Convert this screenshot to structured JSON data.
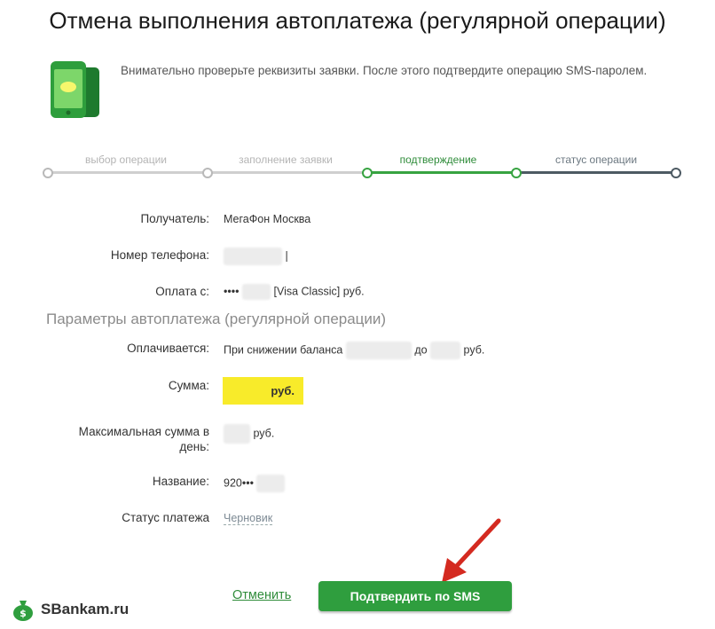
{
  "page": {
    "title": "Отмена выполнения автоплатежа (регулярной операции)",
    "intro": "Внимательно проверьте реквизиты заявки. После этого подтвердите операцию SMS-паролем."
  },
  "steps": [
    {
      "label": "выбор операции",
      "state": "done"
    },
    {
      "label": "заполнение заявки",
      "state": "done"
    },
    {
      "label": "подтверждение",
      "state": "active"
    },
    {
      "label": "статус операции",
      "state": "pending"
    }
  ],
  "details": {
    "recipient_label": "Получатель:",
    "recipient_value": "МегаФон Москва",
    "phone_label": "Номер телефона:",
    "phone_suffix": "|",
    "payfrom_label": "Оплата с:",
    "payfrom_mask": "••••",
    "payfrom_card": "[Visa Classic]",
    "payfrom_currency": "руб."
  },
  "params": {
    "section_title": "Параметры автоплатежа (регулярной операции)",
    "paid_label": "Оплачивается:",
    "paid_text": "При снижении баланса",
    "paid_to": "до",
    "paid_currency": "руб.",
    "amount_label": "Сумма:",
    "amount_currency": "руб.",
    "max_label_line1": "Максимальная сумма в",
    "max_label_line2": "день:",
    "max_currency": "руб.",
    "name_label": "Название:",
    "name_value": "920•••",
    "status_label": "Статус платежа",
    "status_value": "Черновик"
  },
  "actions": {
    "cancel_label": "Отменить",
    "confirm_label": "Подтвердить по SMS"
  },
  "watermark": "SBankam.ru",
  "colors": {
    "accent_green": "#2f9e3e",
    "highlight_yellow": "#f8eb2a",
    "arrow_red": "#d42a20"
  }
}
